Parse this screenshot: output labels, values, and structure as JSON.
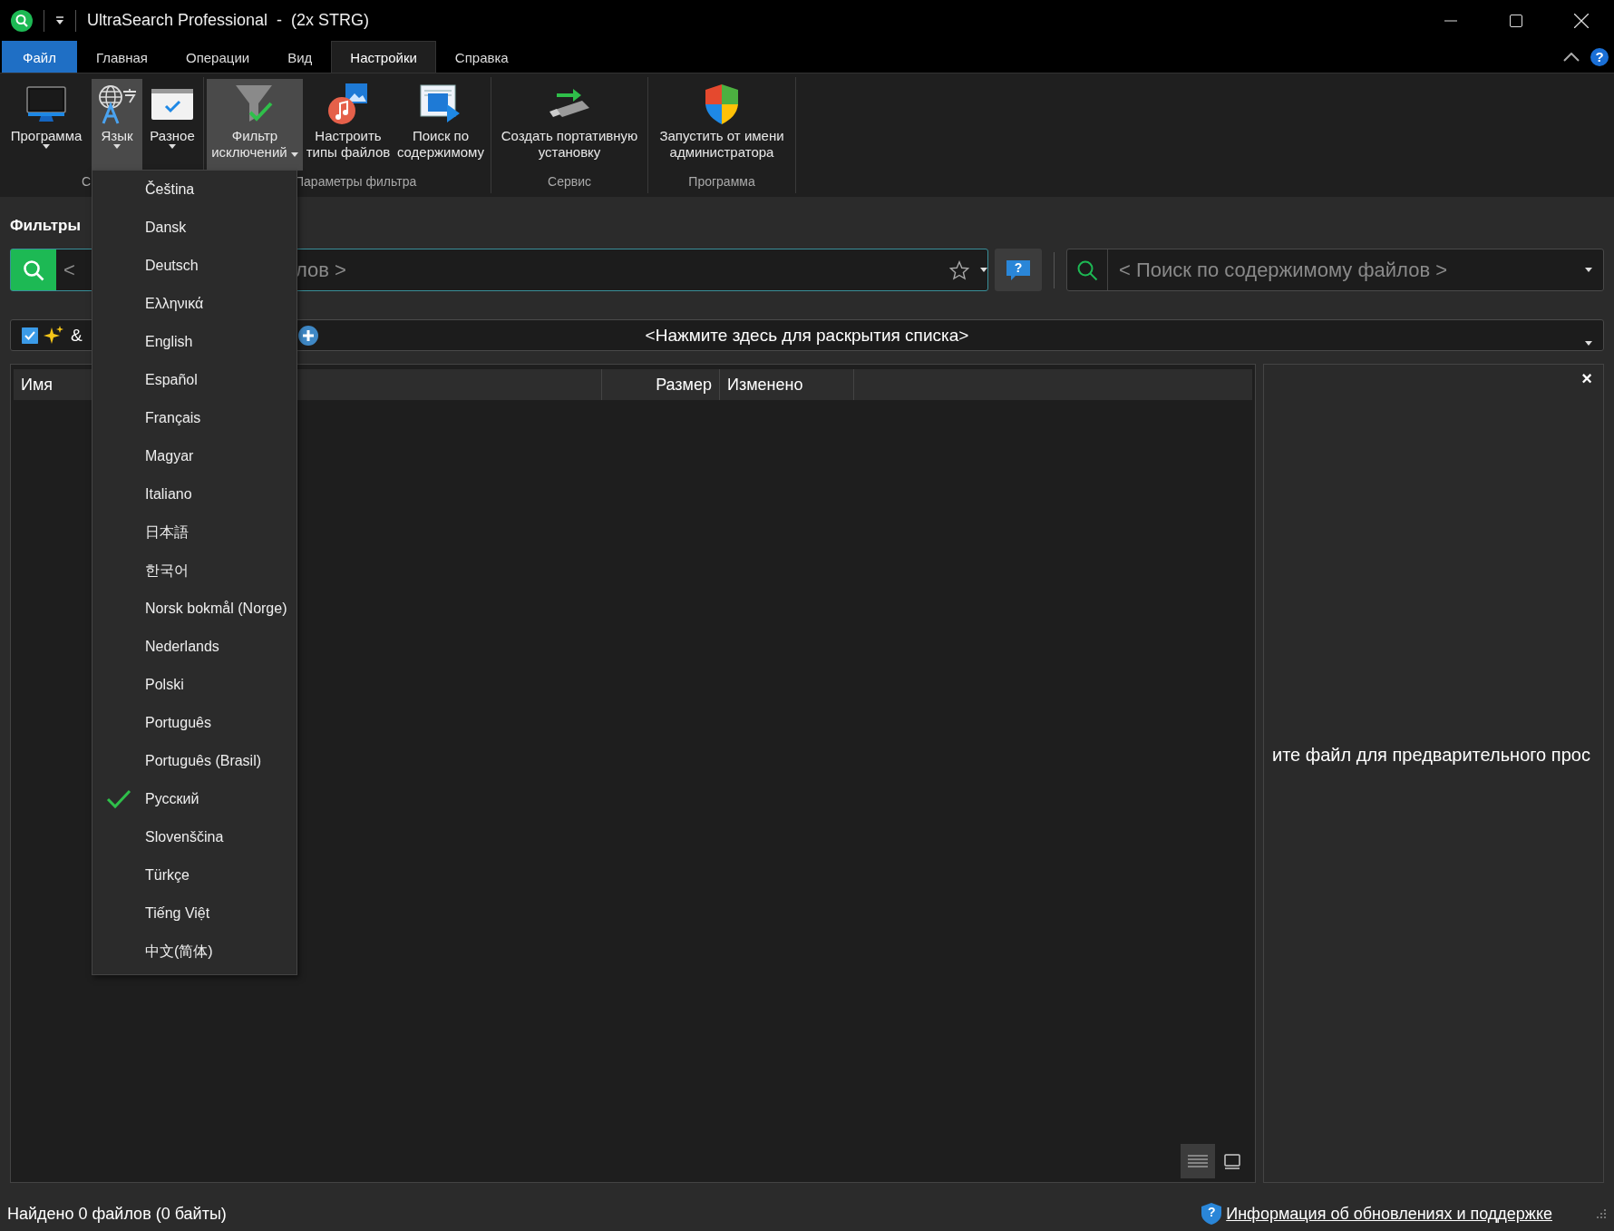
{
  "window": {
    "title": "UltraSearch Professional  -  (2x STRG)"
  },
  "tabs": [
    {
      "label": "Файл",
      "kind": "file",
      "selected": false
    },
    {
      "label": "Главная",
      "kind": "tab",
      "selected": false
    },
    {
      "label": "Операции",
      "kind": "tab",
      "selected": false
    },
    {
      "label": "Вид",
      "kind": "tab",
      "selected": false
    },
    {
      "label": "Настройки",
      "kind": "tab",
      "selected": true
    },
    {
      "label": "Справка",
      "kind": "tab",
      "selected": false
    }
  ],
  "ribbon_help": "?",
  "ribbon": {
    "groups": [
      {
        "label": "С",
        "buttons": [
          {
            "label": "Программа",
            "kind": "menu",
            "pressed": false
          },
          {
            "label": "Язык",
            "kind": "menu",
            "pressed": true
          },
          {
            "label": "Разное",
            "kind": "menu",
            "pressed": false
          }
        ]
      },
      {
        "label": "Параметры фильтра",
        "buttons": [
          {
            "label": "Фильтр\nисключений",
            "kind": "split",
            "pressed": true
          },
          {
            "label": "Настроить\nтипы файлов",
            "pressed": false
          },
          {
            "label": "Поиск по\nсодержимому",
            "pressed": false
          }
        ]
      },
      {
        "label": "Сервис",
        "buttons": [
          {
            "label": "Создать портативную\nустановку",
            "pressed": false
          }
        ]
      },
      {
        "label": "Программа",
        "buttons": [
          {
            "label": "Запустить от имени\nадминистратора",
            "pressed": false
          }
        ]
      }
    ]
  },
  "filters": {
    "label": "Фильтры",
    "name_search": {
      "placeholder_start": "<",
      "placeholder_end": "лов >"
    },
    "help_glyph": "?",
    "content_search": {
      "placeholder": "< Поиск по содержимому файлов >"
    },
    "filter_bar": {
      "checked": true,
      "operator": "&",
      "prompt": "<Нажмите здесь для раскрытия списка>"
    }
  },
  "table": {
    "columns": [
      "Имя",
      "Размер",
      "Изменено"
    ],
    "view_buttons": [
      {
        "selected": true
      },
      {
        "selected": false
      }
    ]
  },
  "preview": {
    "message": "ите файл для предварительного прос",
    "close": "×"
  },
  "status_bar": {
    "found": "Найдено 0 файлов (0 байты)",
    "link": "Информация об обновлениях и поддержке",
    "link_glyph": "?"
  },
  "language_menu": {
    "items": [
      {
        "label": "Čeština",
        "selected": false
      },
      {
        "label": "Dansk",
        "selected": false
      },
      {
        "label": "Deutsch",
        "selected": false
      },
      {
        "label": "Ελληνικά",
        "selected": false
      },
      {
        "label": "English",
        "selected": false
      },
      {
        "label": "Español",
        "selected": false
      },
      {
        "label": "Français",
        "selected": false
      },
      {
        "label": "Magyar",
        "selected": false
      },
      {
        "label": "Italiano",
        "selected": false
      },
      {
        "label": "日本語",
        "selected": false
      },
      {
        "label": "한국어",
        "selected": false
      },
      {
        "label": "Norsk bokmål (Norge)",
        "selected": false
      },
      {
        "label": "Nederlands",
        "selected": false
      },
      {
        "label": "Polski",
        "selected": false
      },
      {
        "label": "Português",
        "selected": false
      },
      {
        "label": "Português (Brasil)",
        "selected": false
      },
      {
        "label": "Русский",
        "selected": true
      },
      {
        "label": "Slovenščina",
        "selected": false
      },
      {
        "label": "Türkçe",
        "selected": false
      },
      {
        "label": "Tiếng Việt",
        "selected": false
      },
      {
        "label": "中文(简体)",
        "selected": false
      }
    ]
  }
}
